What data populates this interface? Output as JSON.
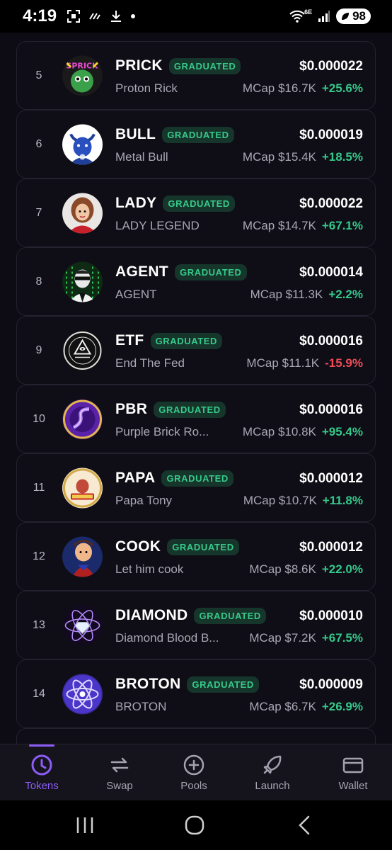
{
  "status_bar": {
    "time": "4:19",
    "network": "6E",
    "battery": "98"
  },
  "tokens": [
    {
      "rank": "5",
      "symbol": "PRICK",
      "name": "Proton Rick",
      "badge": "GRADUATED",
      "price": "$0.000022",
      "mcap": "MCap $16.7K",
      "change": "+25.6%",
      "direction": "up",
      "logo_icon": "prick-token-icon"
    },
    {
      "rank": "6",
      "symbol": "BULL",
      "name": "Metal Bull",
      "badge": "GRADUATED",
      "price": "$0.000019",
      "mcap": "MCap $15.4K",
      "change": "+18.5%",
      "direction": "up",
      "logo_icon": "bull-token-icon"
    },
    {
      "rank": "7",
      "symbol": "LADY",
      "name": "LADY LEGEND",
      "badge": "GRADUATED",
      "price": "$0.000022",
      "mcap": "MCap $14.7K",
      "change": "+67.1%",
      "direction": "up",
      "logo_icon": "lady-token-icon"
    },
    {
      "rank": "8",
      "symbol": "AGENT",
      "name": "AGENT",
      "badge": "GRADUATED",
      "price": "$0.000014",
      "mcap": "MCap $11.3K",
      "change": "+2.2%",
      "direction": "up",
      "logo_icon": "agent-token-icon"
    },
    {
      "rank": "9",
      "symbol": "ETF",
      "name": "End The Fed",
      "badge": "GRADUATED",
      "price": "$0.000016",
      "mcap": "MCap $11.1K",
      "change": "-15.9%",
      "direction": "down",
      "logo_icon": "etf-token-icon"
    },
    {
      "rank": "10",
      "symbol": "PBR",
      "name": "Purple Brick Ro...",
      "badge": "GRADUATED",
      "price": "$0.000016",
      "mcap": "MCap $10.8K",
      "change": "+95.4%",
      "direction": "up",
      "logo_icon": "pbr-token-icon"
    },
    {
      "rank": "11",
      "symbol": "PAPA",
      "name": "Papa Tony",
      "badge": "GRADUATED",
      "price": "$0.000012",
      "mcap": "MCap $10.7K",
      "change": "+11.8%",
      "direction": "up",
      "logo_icon": "papa-token-icon"
    },
    {
      "rank": "12",
      "symbol": "COOK",
      "name": "Let him cook",
      "badge": "GRADUATED",
      "price": "$0.000012",
      "mcap": "MCap $8.6K",
      "change": "+22.0%",
      "direction": "up",
      "logo_icon": "cook-token-icon"
    },
    {
      "rank": "13",
      "symbol": "DIAMOND",
      "name": "Diamond Blood B...",
      "badge": "GRADUATED",
      "price": "$0.000010",
      "mcap": "MCap $7.2K",
      "change": "+67.5%",
      "direction": "up",
      "logo_icon": "diamond-token-icon"
    },
    {
      "rank": "14",
      "symbol": "BROTON",
      "name": "BROTON",
      "badge": "GRADUATED",
      "price": "$0.000009",
      "mcap": "MCap $6.7K",
      "change": "+26.9%",
      "direction": "up",
      "logo_icon": "broton-token-icon"
    }
  ],
  "bottom_nav": [
    {
      "label": "Tokens",
      "icon": "clock-icon",
      "active": true
    },
    {
      "label": "Swap",
      "icon": "swap-arrows-icon",
      "active": false
    },
    {
      "label": "Pools",
      "icon": "plus-circle-icon",
      "active": false
    },
    {
      "label": "Launch",
      "icon": "rocket-icon",
      "active": false
    },
    {
      "label": "Wallet",
      "icon": "wallet-icon",
      "active": false
    }
  ],
  "colors": {
    "accent": "#8d5cf6",
    "positive": "#34c98a",
    "negative": "#ef4c57",
    "badge_bg": "#16352b",
    "background": "#0d0c14"
  }
}
